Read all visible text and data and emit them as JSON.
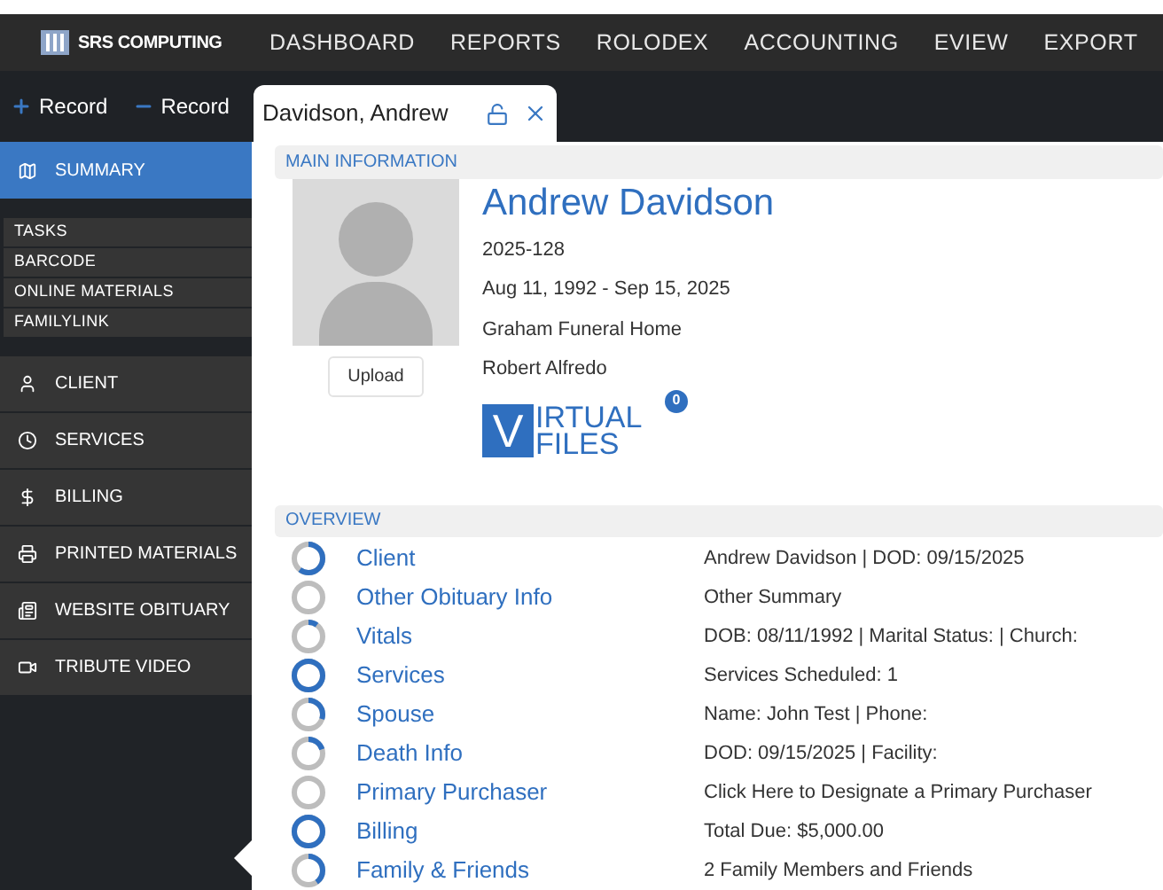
{
  "brand": "SRS COMPUTING",
  "nav": [
    "DASHBOARD",
    "REPORTS",
    "ROLODEX",
    "ACCOUNTING",
    "EVIEW",
    "EXPORT"
  ],
  "toolbar": [
    {
      "kind": "add",
      "label": "Record"
    },
    {
      "kind": "remove",
      "label": "Record"
    }
  ],
  "tab": {
    "label": "Davidson, Andrew"
  },
  "sidebar": {
    "items": [
      {
        "label": "SUMMARY",
        "selected": true
      }
    ],
    "subitems": [
      "TASKS",
      "BARCODE",
      "ONLINE MATERIALS",
      "FAMILYLINK"
    ],
    "sections": [
      {
        "label": "CLIENT",
        "selected": false
      },
      {
        "label": "SERVICES",
        "selected": false
      },
      {
        "label": "BILLING",
        "selected": false
      },
      {
        "label": "PRINTED MATERIALS",
        "selected": false
      },
      {
        "label": "WEBSITE OBITUARY",
        "selected": false
      },
      {
        "label": "TRIBUTE VIDEO",
        "selected": false
      }
    ]
  },
  "main_information": {
    "header": "MAIN INFORMATION",
    "upload": "Upload",
    "name": "Andrew Davidson",
    "details": [
      "2025-128",
      "Aug 11, 1992 - Sep 15, 2025",
      "Graham Funeral Home",
      "Robert Alfredo"
    ],
    "virtual_files": {
      "letter": "V",
      "line_1": "IRTUAL",
      "line_2": "FILES",
      "badge": "0"
    }
  },
  "overview": {
    "header": "OVERVIEW",
    "rows": [
      {
        "label": "Client",
        "summary": "Andrew Davidson | DOD: 09/15/2025",
        "level": 0.6
      },
      {
        "label": "Other Obituary Info",
        "summary": "Other Summary",
        "level": 0
      },
      {
        "label": "Vitals",
        "summary": "DOB: 08/11/1992 | Marital Status: | Church:",
        "level": 0.1
      },
      {
        "label": "Services",
        "summary": "Services Scheduled: 1",
        "level": 1
      },
      {
        "label": "Spouse",
        "summary": "Name: John Test | Phone:",
        "level": 0.3
      },
      {
        "label": "Death Info",
        "summary": "DOD: 09/15/2025 | Facility:",
        "level": 0.2
      },
      {
        "label": "Primary Purchaser",
        "summary": "Click Here to Designate a Primary Purchaser",
        "level": 0
      },
      {
        "label": "Billing",
        "summary": "Total Due: $5,000.00",
        "level": 1
      },
      {
        "label": "Family & Friends",
        "summary": "2 Family Members and Friends",
        "level": 0.4
      }
    ]
  }
}
